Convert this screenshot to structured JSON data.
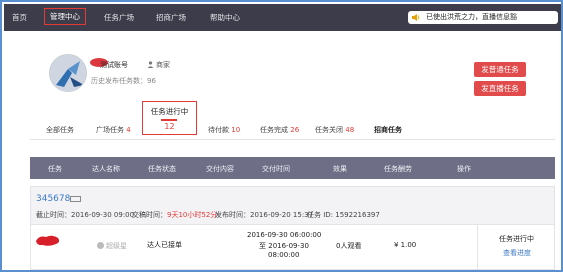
{
  "nav": {
    "home": "首页",
    "manage": "管理中心",
    "task_square": "任务广场",
    "recruit_square": "招商广场",
    "help": "帮助中心",
    "notice": "已使出洪荒之力，直播信息豁",
    "speaker_icon": "speaker-icon"
  },
  "profile": {
    "username": "测试账号",
    "role": "商家",
    "history": "历史发布任务数：96",
    "btn_normal": "发普通任务",
    "btn_recruit": "发直播任务"
  },
  "tabs": [
    {
      "label": "全部任务",
      "count": ""
    },
    {
      "label": "广场任务",
      "count": "4"
    },
    {
      "label": "任务进行中",
      "count": "12"
    },
    {
      "label": "待付款",
      "count": "10"
    },
    {
      "label": "任务完成",
      "count": "26"
    },
    {
      "label": "任务关闭",
      "count": "48"
    },
    {
      "label": "招商任务",
      "count": ""
    }
  ],
  "table": {
    "headers": [
      "任务",
      "达人名称",
      "任务状态",
      "交付内容",
      "交付时间",
      "效果",
      "任务酬劳",
      "操作"
    ]
  },
  "task": {
    "id": "345678",
    "deadline_label": "截止时间：",
    "deadline": "2016-09-30 09:00",
    "countdown_label": "交稿时间：",
    "countdown": "9天10小时52分",
    "publish_label": "发布时间：",
    "publish": "2016-09-20 15:37",
    "task_id_label": "任务 ID: ",
    "task_id": "1592216397",
    "row": {
      "talent": "超级星",
      "status": "达人已接单",
      "time_from": "2016-09-30 06:00:00",
      "time_to_prefix": "至 ",
      "time_to_date": "2016-09-30",
      "time_to_time": "08:00:00",
      "effect": "0人观看",
      "reward": "¥ 1.00",
      "state": "任务进行中",
      "action": "查看进度"
    }
  },
  "colors": {
    "accent_red": "#e53935",
    "nav_bg": "#3c3c4a",
    "table_header_bg": "#6e6f87",
    "link_blue": "#3b79c4"
  }
}
